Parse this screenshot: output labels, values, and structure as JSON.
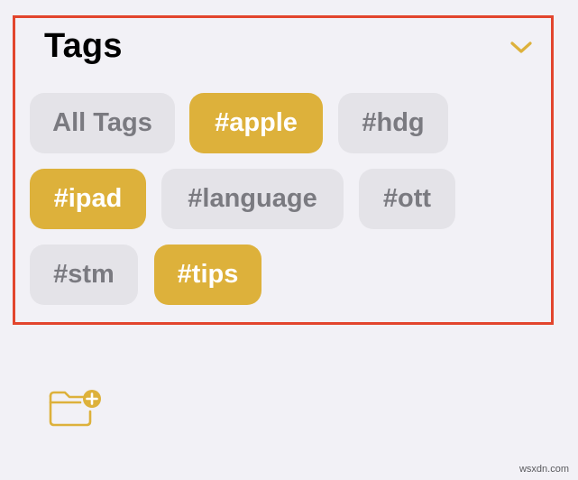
{
  "tags_section": {
    "title": "Tags",
    "collapse_icon": "chevron-down-icon",
    "tags": [
      {
        "label": "All Tags",
        "selected": false
      },
      {
        "label": "#apple",
        "selected": true
      },
      {
        "label": "#hdg",
        "selected": false
      },
      {
        "label": "#ipad",
        "selected": true
      },
      {
        "label": "#language",
        "selected": false
      },
      {
        "label": "#ott",
        "selected": false
      },
      {
        "label": "#stm",
        "selected": false
      },
      {
        "label": "#tips",
        "selected": true
      }
    ]
  },
  "toolbar": {
    "new_folder_icon": "new-folder-icon"
  },
  "watermark": "wsxdn.com",
  "colors": {
    "accent": "#ddb13b",
    "highlight_border": "#e2452d",
    "tag_unselected_bg": "#e4e3e8",
    "tag_unselected_text": "#7a7a80",
    "background": "#f2f1f6"
  }
}
